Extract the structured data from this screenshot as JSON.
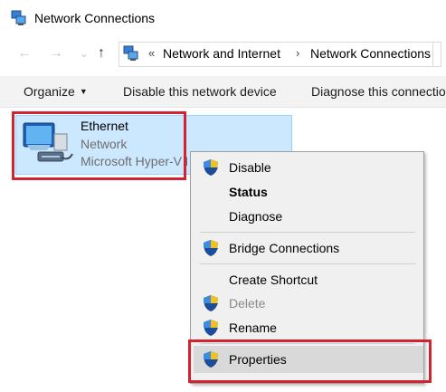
{
  "window": {
    "title": "Network Connections"
  },
  "address_bar": {
    "overflow": "«",
    "crumbs": [
      "Network and Internet",
      "Network Connections"
    ],
    "separator": "›"
  },
  "navigation": {
    "back": "←",
    "forward": "→",
    "recent": "⌄",
    "up": "↑"
  },
  "command_bar": {
    "organize": "Organize",
    "disable_device": "Disable this network device",
    "diagnose": "Diagnose this connection"
  },
  "adapter": {
    "name": "Ethernet",
    "status": "Network",
    "device": "Microsoft Hyper-V Network Adapter"
  },
  "context_menu": {
    "items": [
      {
        "label": "Disable",
        "icon": "uac-shield-icon"
      },
      {
        "label": "Status",
        "bold": true
      },
      {
        "label": "Diagnose"
      },
      {
        "label": "Bridge Connections",
        "icon": "uac-shield-icon"
      },
      {
        "label": "Create Shortcut"
      },
      {
        "label": "Delete",
        "icon": "uac-shield-icon",
        "disabled": true
      },
      {
        "label": "Rename",
        "icon": "uac-shield-icon"
      },
      {
        "label": "Properties",
        "icon": "uac-shield-icon",
        "highlighted": true
      }
    ]
  },
  "colors": {
    "selection": "#cce8ff",
    "annotation_red": "#d32330",
    "menu_bg": "#f0f0f0"
  }
}
